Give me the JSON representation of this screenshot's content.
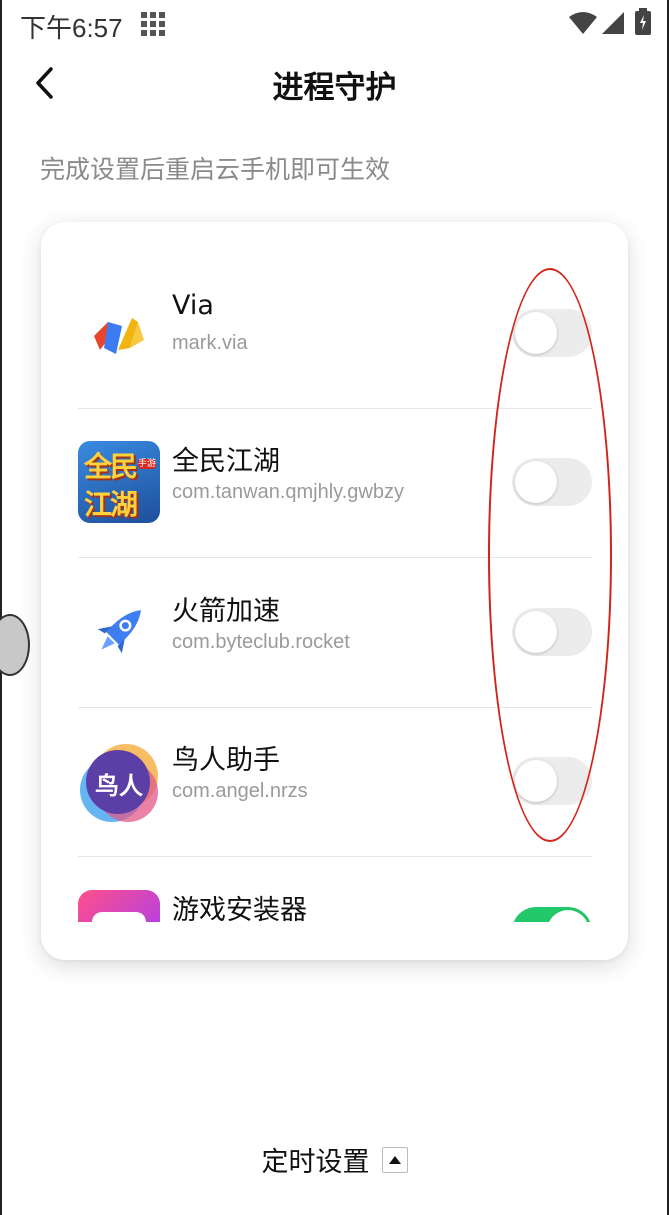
{
  "status_bar": {
    "time": "下午6:57",
    "icons": [
      "grid-icon",
      "wifi-icon",
      "signal-icon",
      "battery-icon"
    ]
  },
  "header": {
    "back_icon": "chevron-left-icon",
    "title": "进程守护"
  },
  "notice": "完成设置后重启云手机即可生效",
  "apps": [
    {
      "name": "Via",
      "package": "mark.via",
      "enabled": false,
      "icon": "via-app-icon"
    },
    {
      "name": "全民江湖",
      "package": "com.tanwan.qmjhly.gwbzy",
      "enabled": false,
      "icon": "quanmin-jianghu-app-icon",
      "icon_text_top": "全民",
      "icon_text_bottom": "江湖",
      "icon_badge": "手游"
    },
    {
      "name": "火箭加速",
      "package": "com.byteclub.rocket",
      "enabled": false,
      "icon": "rocket-app-icon"
    },
    {
      "name": "鸟人助手",
      "package": "com.angel.nrzs",
      "enabled": false,
      "icon": "niaoren-app-icon",
      "icon_text": "鸟人"
    },
    {
      "name": "游戏安装器",
      "package": "",
      "enabled": true,
      "icon": "game-installer-app-icon"
    }
  ],
  "footer": {
    "timer_label": "定时设置",
    "expand_icon": "triangle-up-icon"
  },
  "colors": {
    "toggle_on": "#22c96a",
    "toggle_off": "#ececec",
    "annotation": "#d2241b"
  }
}
